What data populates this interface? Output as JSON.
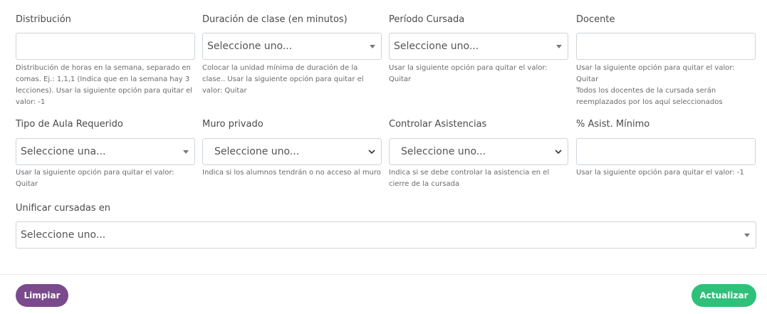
{
  "row1": {
    "distribucion": {
      "label": "Distribución",
      "value": "",
      "help": [
        "Distribución de horas en la semana, separado en comas. Ej.: 1,1,1 (Indica que en la semana hay 3 lecciones). Usar la siguiente opción para quitar el valor: -1"
      ]
    },
    "duracion": {
      "label": "Duración de clase (en minutos)",
      "selected": "Seleccione uno...",
      "help": [
        "Colocar la unidad mínima de duración de la clase.. Usar la siguiente opción para quitar el valor: Quitar"
      ]
    },
    "periodo": {
      "label": "Período Cursada",
      "selected": "Seleccione uno...",
      "help": [
        "Usar la siguiente opción para quitar el valor: Quitar"
      ]
    },
    "docente": {
      "label": "Docente",
      "value": "",
      "help": [
        "Usar la siguiente opción para quitar el valor: Quitar",
        "Todos los docentes de la cursada serán reemplazados por los aquí seleccionados"
      ]
    }
  },
  "row2": {
    "tipo_aula": {
      "label": "Tipo de Aula Requerido",
      "selected": "Seleccione una...",
      "help": [
        "Usar la siguiente opción para quitar el valor: Quitar"
      ]
    },
    "muro": {
      "label": "Muro privado",
      "selected": "Seleccione uno...",
      "help": [
        "Indica si los alumnos tendrán o no acceso al muro"
      ]
    },
    "asistencias": {
      "label": "Controlar Asistencias",
      "selected": "Seleccione uno...",
      "help": [
        "Indica si se debe controlar la asistencia en el cierre de la cursada"
      ]
    },
    "asist_minimo": {
      "label": "% Asist. Mínimo",
      "value": "",
      "help": [
        "Usar la siguiente opción para quitar el valor: -1"
      ]
    }
  },
  "unificar": {
    "label": "Unificar cursadas en",
    "selected": "Seleccione uno..."
  },
  "footer": {
    "clear_label": "Limpiar",
    "update_label": "Actualizar"
  },
  "colors": {
    "clear_button": "#7a4a8c",
    "update_button": "#2fc07a"
  }
}
